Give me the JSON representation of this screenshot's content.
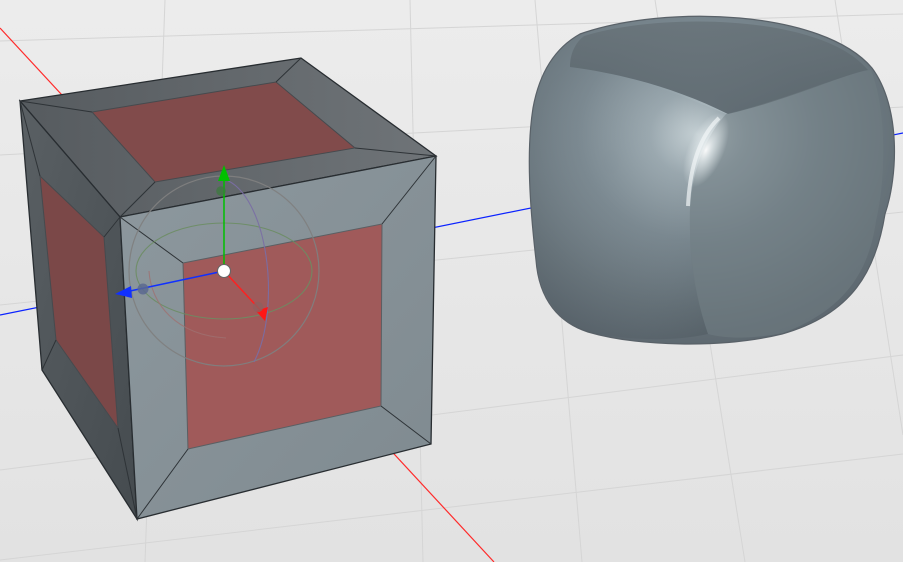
{
  "viewport": {
    "background_color": "#e8e8e8",
    "grid_color": "#d3d3d3",
    "axis_colors": {
      "x": "#ff0000",
      "y": "#00c000",
      "z": "#0000ff"
    }
  },
  "objects": [
    {
      "name": "cube",
      "colors": {
        "frame_top": "#6b6f73",
        "frame_left": "#4f5558",
        "frame_front": "#8c979d",
        "inner_panels": "#a65b5b"
      }
    },
    {
      "name": "rounded-cube",
      "colors": {
        "base": "#7c8b93",
        "highlight": "#d8e2e6",
        "shadow": "#4e5960"
      }
    }
  ],
  "gizmo": {
    "type": "rotate-move-gizmo",
    "colors": {
      "ring": "#777777",
      "x": "#ff0000",
      "y": "#00c000",
      "z": "#0000ff",
      "center": "#ffffff"
    }
  }
}
